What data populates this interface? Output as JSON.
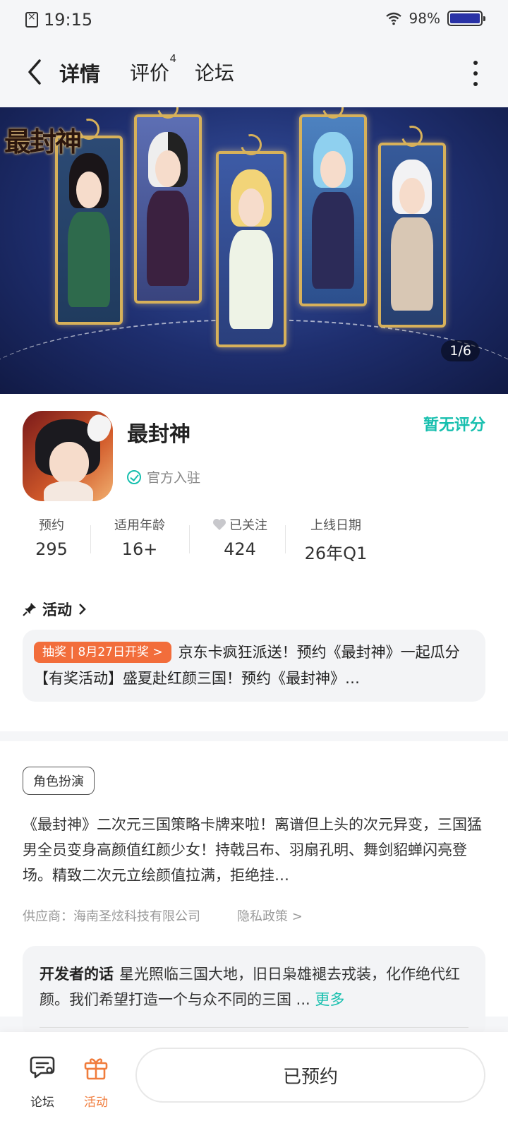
{
  "status_bar": {
    "time": "19:15",
    "battery": "98%",
    "icons": [
      "sim-off-icon",
      "wifi-icon",
      "battery-icon"
    ]
  },
  "nav": {
    "tabs": [
      {
        "label": "详情",
        "active": true
      },
      {
        "label": "评价",
        "badge": "4"
      },
      {
        "label": "论坛"
      }
    ],
    "icons": [
      "back-arrow-icon",
      "more-dots-icon"
    ]
  },
  "banner": {
    "logo_text": "最封神",
    "pager": "1/6"
  },
  "app": {
    "name": "最封神",
    "rating": "暂无评分",
    "official": "官方入驻"
  },
  "stats": [
    {
      "label": "预约",
      "value": "295"
    },
    {
      "label": "适用年龄",
      "value": "16+"
    },
    {
      "label": "已关注",
      "value": "424"
    },
    {
      "label": "上线日期",
      "value": "26年Q1"
    }
  ],
  "activity": {
    "title": "活动",
    "tag": "抽奖 | 8月27日开奖 >",
    "text": "京东卡疯狂派送！预约《最封神》一起瓜分 【有奖活动】盛夏赴红颜三国！预约《最封神》…"
  },
  "description": {
    "genre": "角色扮演",
    "text": "《最封神》二次元三国策略卡牌来啦！离谱但上头的次元异变，三国猛男全员变身高颜值红颜少女！持戟吕布、羽扇孔明、舞剑貂蝉闪亮登场。精致二次元立绘颜值拉满，拒绝挂…",
    "supplier": "供应商：海南圣炫科技有限公司",
    "privacy": "隐私政策 >"
  },
  "developer": {
    "title": "开发者的话",
    "text": "星光照临三国大地，旧日枭雄褪去戎装，化作绝代红颜。我们希望打造一个与众不同的三国 ...",
    "more": "更多"
  },
  "bottom_bar": {
    "forum": "论坛",
    "activity": "活动",
    "reserve": "已预约"
  },
  "colors": {
    "accent": "#17bfae",
    "orange": "#f26d3b",
    "battery": "#2932a6"
  }
}
